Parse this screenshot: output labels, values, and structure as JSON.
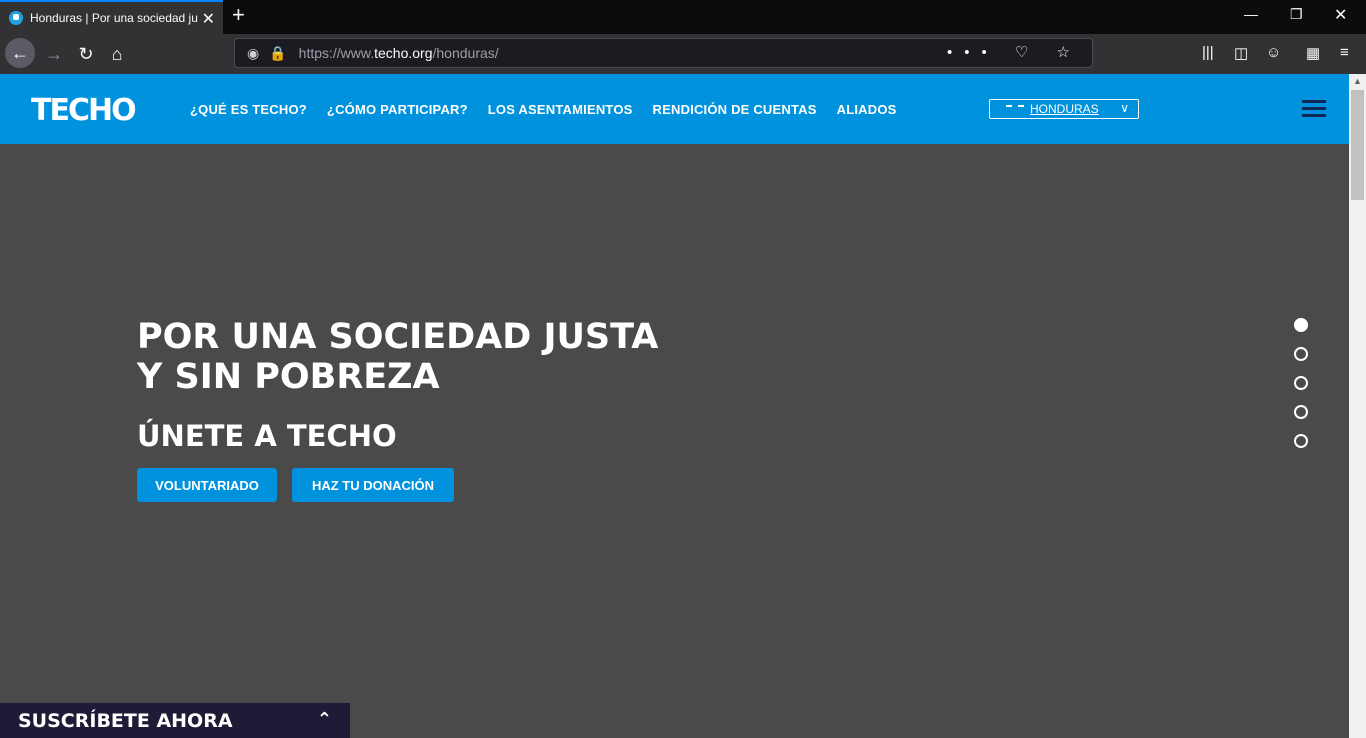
{
  "browser": {
    "tab_title": "Honduras | Por una sociedad ju",
    "close_glyph": "✕",
    "new_tab_glyph": "+",
    "url_domain_prefix": "https://www.",
    "url_domain": "techo.org",
    "url_path": "/honduras/",
    "url_actions": "••• ♡ ☆"
  },
  "header": {
    "logo_text": "TECHO",
    "menu": [
      "¿QUÉ ES TECHO?",
      "¿CÓMO PARTICIPAR?",
      "LOS ASENTAMIENTOS",
      "RENDICIÓN DE CUENTAS",
      "ALIADOS"
    ],
    "country": "HONDURAS"
  },
  "hero": {
    "title_line1": "POR UNA SOCIEDAD JUSTA",
    "title_line2": "Y SIN POBREZA",
    "subtitle": "ÚNETE A TECHO",
    "btn_volunteer": "VOLUNTARIADO",
    "btn_donate": "HAZ TU DONACIÓN",
    "slides_total": 5,
    "active_slide": 1
  },
  "subscribe": {
    "label": "SUSCRÍBETE AHORA"
  },
  "colors": {
    "brand_blue": "#0092dd",
    "hero_bg": "#4a4a4a",
    "subscribe_bg": "#1f1a35"
  }
}
